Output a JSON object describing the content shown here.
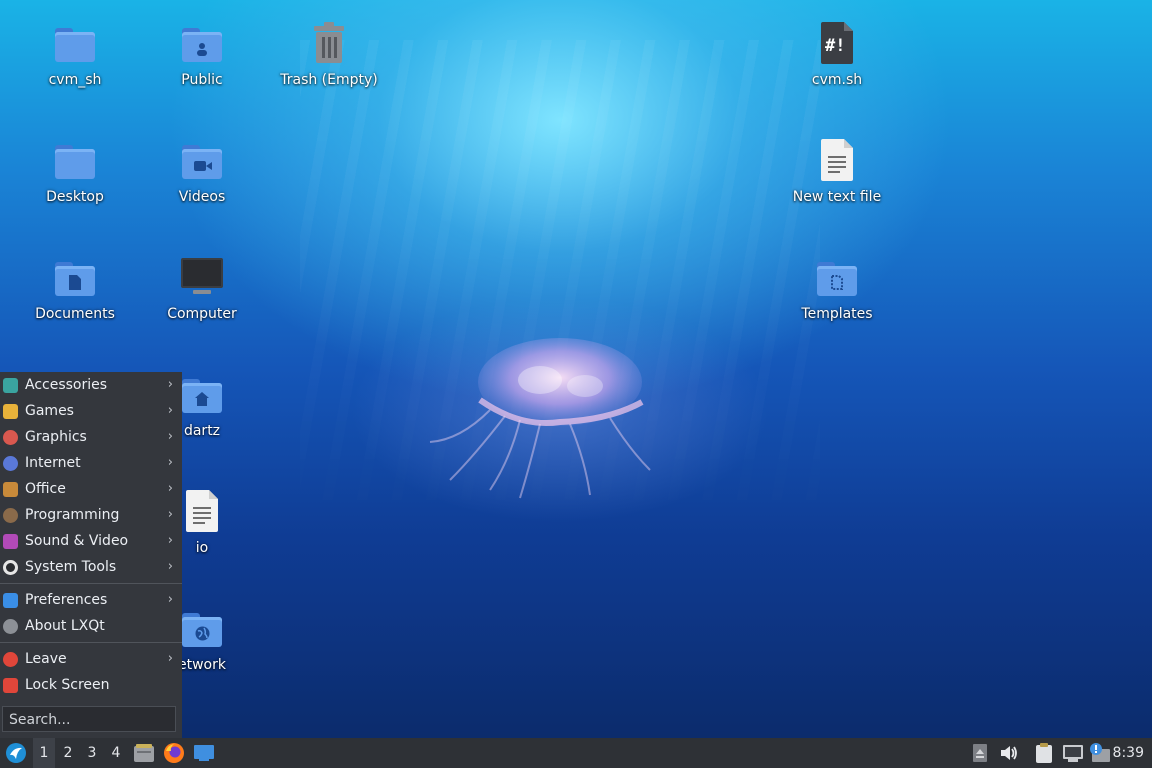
{
  "desktop": {
    "icons": [
      {
        "label": "cvm_sh"
      },
      {
        "label": "Public"
      },
      {
        "label": "Trash (Empty)"
      },
      {
        "label": "cvm.sh"
      },
      {
        "label": "Desktop"
      },
      {
        "label": "Videos"
      },
      {
        "label": "New text file"
      },
      {
        "label": "Documents"
      },
      {
        "label": "Computer"
      },
      {
        "label": "Templates"
      },
      {
        "label": "dartz"
      },
      {
        "label": "io"
      },
      {
        "label": "etwork"
      }
    ],
    "script_icon_glyph": "#!"
  },
  "menu": {
    "items": [
      {
        "label": "Accessories",
        "color": "#3aa4a0"
      },
      {
        "label": "Games",
        "color": "#e8b23a"
      },
      {
        "label": "Graphics",
        "color": "#d9584f"
      },
      {
        "label": "Internet",
        "color": "#5a78d8"
      },
      {
        "label": "Office",
        "color": "#c88a3a"
      },
      {
        "label": "Programming",
        "color": "#8a6a4a"
      },
      {
        "label": "Sound & Video",
        "color": "#b24ab8"
      },
      {
        "label": "System Tools",
        "color": "#e6e6e6"
      },
      {
        "label": "Preferences",
        "color": "#3a8ee6"
      },
      {
        "label": "About LXQt",
        "color": "#8c9096"
      },
      {
        "label": "Leave",
        "color": "#e0463a"
      },
      {
        "label": "Lock Screen",
        "color": "#e0463a"
      }
    ],
    "submenu_arrow": "›",
    "search_placeholder": "Search..."
  },
  "panel": {
    "desktops": [
      "1",
      "2",
      "3",
      "4"
    ],
    "clock": "8:39"
  }
}
